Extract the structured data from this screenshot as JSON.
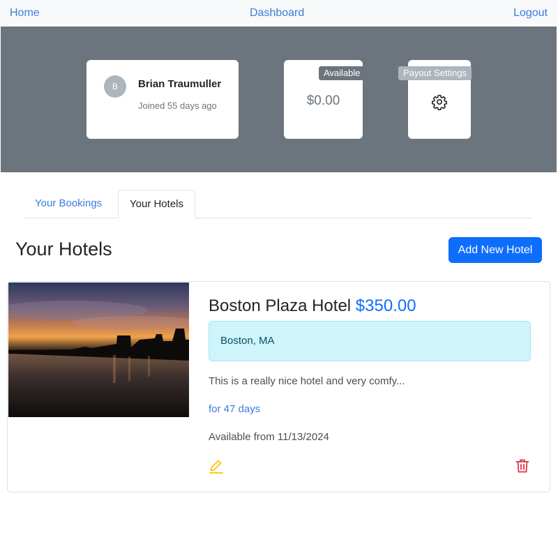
{
  "nav": {
    "home": "Home",
    "dashboard": "Dashboard",
    "logout": "Logout"
  },
  "user": {
    "initial": "B",
    "name": "Brian Traumuller",
    "joined": "Joined 55 days ago"
  },
  "balance": {
    "badge": "Available",
    "value": "$0.00"
  },
  "payout": {
    "badge": "Payout Settings",
    "icon": "gear-icon"
  },
  "tabs": [
    {
      "label": "Your Bookings",
      "active": false
    },
    {
      "label": "Your Hotels",
      "active": true
    }
  ],
  "section": {
    "title": "Your Hotels",
    "add_button": "Add New Hotel"
  },
  "hotels": [
    {
      "name": "Boston Plaza Hotel",
      "price": "$350.00",
      "location": "Boston, MA",
      "description": "This is a really nice hotel and very comfy...",
      "duration": "for 47 days",
      "available_from": "Available from 11/13/2024",
      "edit_icon": "pencil-icon",
      "delete_icon": "trash-icon"
    }
  ],
  "colors": {
    "primary": "#0d6efd",
    "link": "#3b7ddd",
    "hero_bg": "#6c757d",
    "info_bg": "#cff4fc",
    "edit": "#ffc107",
    "delete": "#dc3545"
  }
}
